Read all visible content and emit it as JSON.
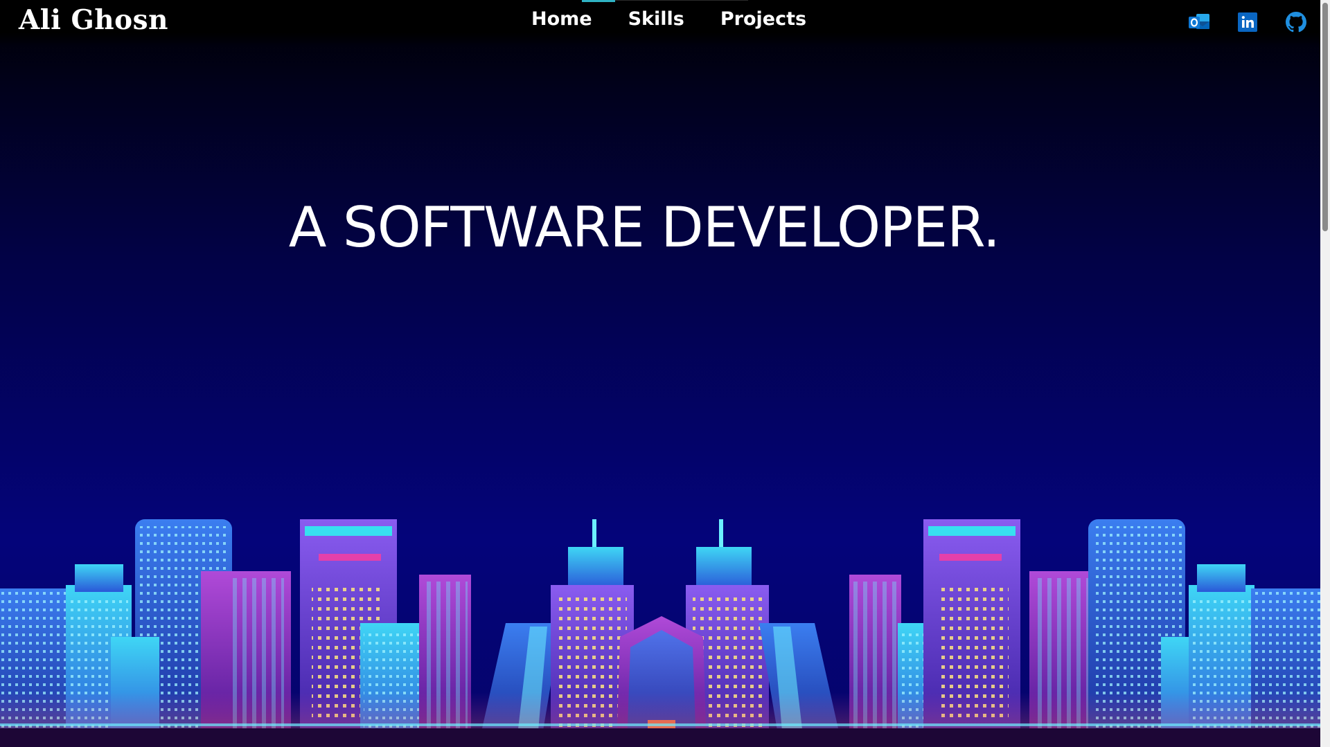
{
  "header": {
    "brand": "Ali Ghosn",
    "nav": [
      {
        "label": "Home"
      },
      {
        "label": "Skills"
      },
      {
        "label": "Projects"
      }
    ],
    "socials": [
      {
        "icon": "outlook-icon",
        "color": "#0f78d4"
      },
      {
        "icon": "linkedin-icon",
        "color": "#0a66c2"
      },
      {
        "icon": "github-icon",
        "color": "#1f8fe0"
      }
    ]
  },
  "hero": {
    "headline": "A SOFTWARE DEVELOPER."
  },
  "colors": {
    "accent": "#2fb2c4",
    "sky_top": "#000000",
    "sky_bottom": "#04047a",
    "neon_cyan": "#37e0f0",
    "neon_purple": "#a050f0",
    "neon_pink": "#ff3c9c"
  }
}
